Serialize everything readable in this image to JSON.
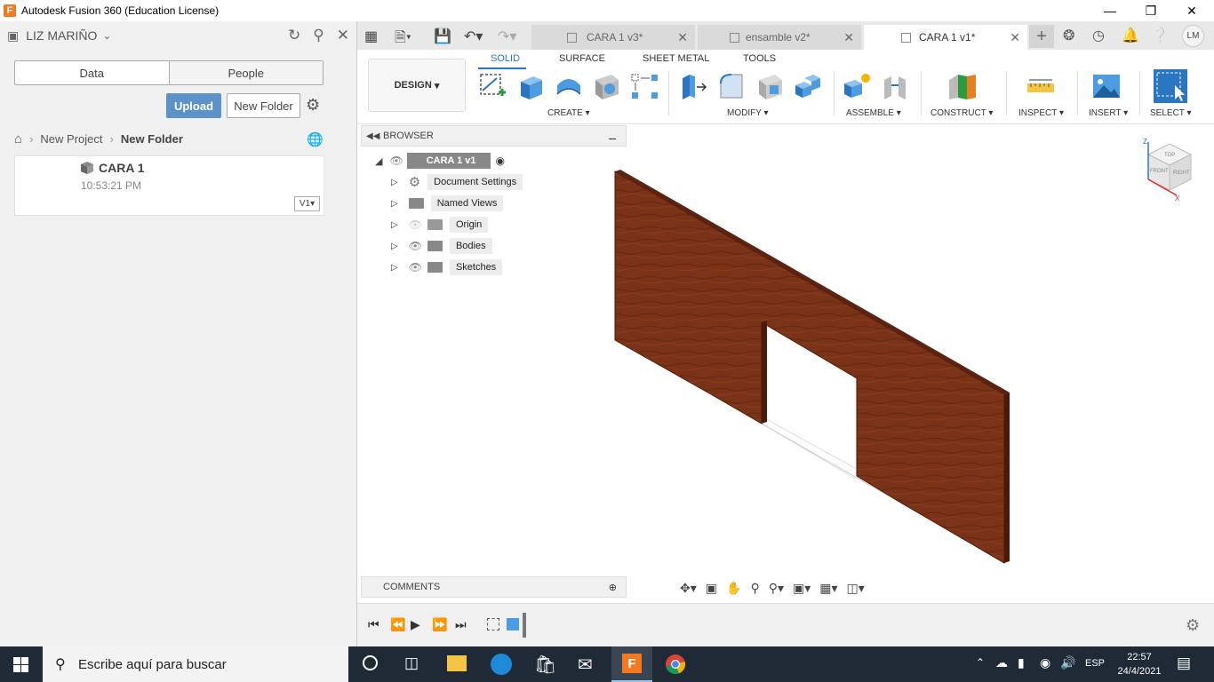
{
  "window": {
    "title": "Autodesk Fusion 360 (Education License)",
    "app_icon_letter": "F"
  },
  "data_panel": {
    "user": "LIZ MARIÑO",
    "tabs": [
      "Data",
      "People"
    ],
    "upload_label": "Upload",
    "new_folder_label": "New Folder",
    "breadcrumb": [
      "New Project",
      "New Folder"
    ],
    "file": {
      "name": "CARA 1",
      "time": "10:53:21 PM",
      "version": "V1"
    }
  },
  "document_tabs": [
    {
      "label": "CARA 1 v3*",
      "active": false
    },
    {
      "label": "ensamble v2*",
      "active": false
    },
    {
      "label": "CARA 1 v1*",
      "active": true
    }
  ],
  "avatar_initials": "LM",
  "toolbar": {
    "workspace": "DESIGN",
    "workspace_tabs": [
      "SOLID",
      "SURFACE",
      "SHEET METAL",
      "TOOLS"
    ],
    "groups": [
      "CREATE",
      "MODIFY",
      "ASSEMBLE",
      "CONSTRUCT",
      "INSPECT",
      "INSERT",
      "SELECT"
    ]
  },
  "browser": {
    "header": "BROWSER",
    "root": "CARA 1 v1",
    "items": [
      "Document Settings",
      "Named Views",
      "Origin",
      "Bodies",
      "Sketches"
    ]
  },
  "comments": {
    "header": "COMMENTS"
  },
  "viewcube": {
    "top": "TOP",
    "front": "FRONT",
    "right": "RIGHT",
    "z": "Z",
    "x": "X"
  },
  "taskbar": {
    "search_placeholder": "Escribe aquí para buscar",
    "lang": "ESP",
    "time": "22:57",
    "date": "24/4/2021"
  },
  "colors": {
    "accent": "#2b76c1",
    "upload": "#5b93c8",
    "wood": "#7a3318",
    "taskbar": "#1f2a36"
  }
}
